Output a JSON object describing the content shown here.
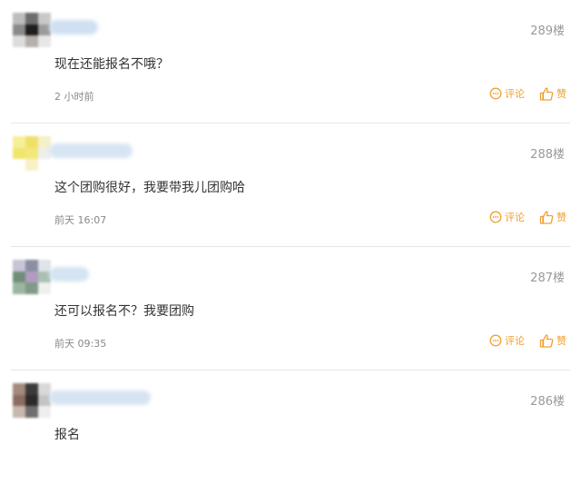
{
  "accent_color": "#f0a030",
  "posts": [
    {
      "floor": "289楼",
      "content": "现在还能报名不哦？",
      "time": "2 小时前",
      "comment_label": "评论",
      "like_label": "赞"
    },
    {
      "floor": "288楼",
      "content": "这个团购很好，我要带我儿团购哈",
      "time": "前天 16:07",
      "comment_label": "评论",
      "like_label": "赞"
    },
    {
      "floor": "287楼",
      "content": "还可以报名不？我要团购",
      "time": "前天 09:35",
      "comment_label": "评论",
      "like_label": "赞"
    },
    {
      "floor": "286楼",
      "content": "报名",
      "time": "",
      "comment_label": "",
      "like_label": ""
    }
  ]
}
